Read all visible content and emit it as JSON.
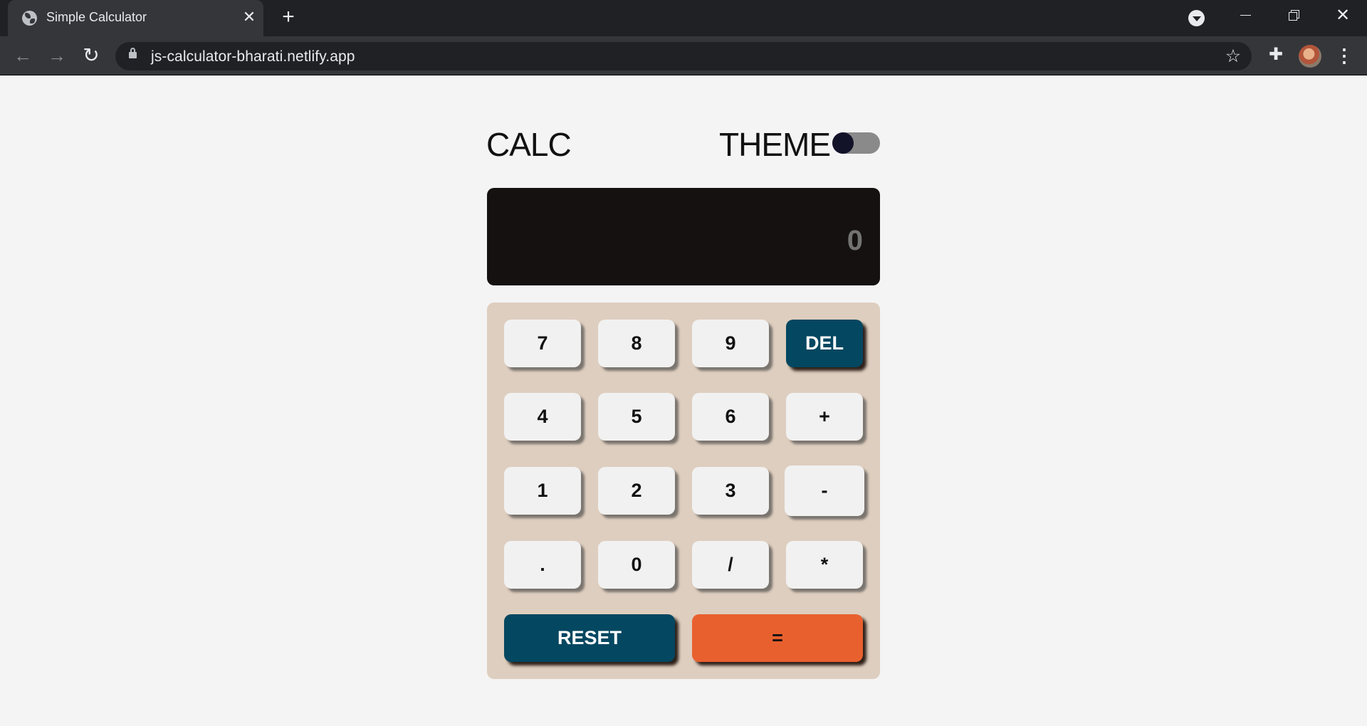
{
  "browser": {
    "tab_title": "Simple Calculator",
    "tab_close": "✕",
    "new_tab": "+",
    "url": "js-calculator-bharati.netlify.app",
    "back_icon": "←",
    "forward_icon": "→",
    "reload_icon": "↻",
    "star_icon": "☆",
    "extensions_icon": "✚",
    "menu_icon": "⋮",
    "close_window": "✕"
  },
  "app": {
    "title": "CALC",
    "theme_label": "THEME",
    "theme_toggle_on": false,
    "display_value": "0"
  },
  "keypad": {
    "row1": [
      "7",
      "8",
      "9",
      "DEL"
    ],
    "row2": [
      "4",
      "5",
      "6",
      "+"
    ],
    "row3": [
      "1",
      "2",
      "3",
      "-"
    ],
    "row4": [
      ".",
      "0",
      "/",
      "*"
    ],
    "row5": [
      "RESET",
      "="
    ]
  },
  "colors": {
    "page_bg": "#f4f4f4",
    "display_bg": "#151111",
    "keypad_bg": "#decebf",
    "key_bg": "#f1f1f1",
    "accent_dark": "#044760",
    "accent_orange": "#e9602f"
  }
}
